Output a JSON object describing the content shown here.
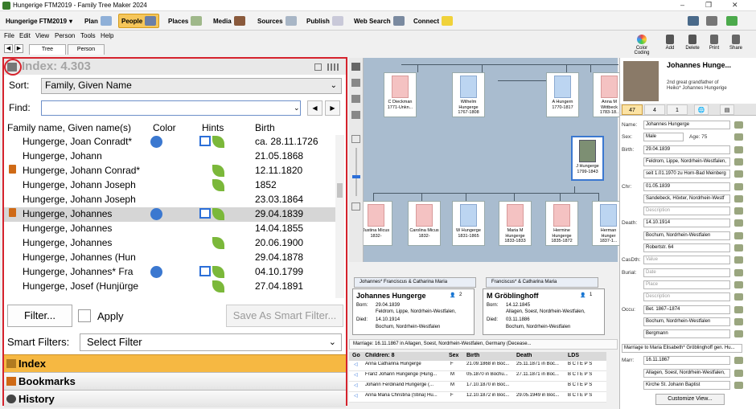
{
  "window": {
    "title": "Hungerige FTM2019 - Family Tree Maker 2024",
    "controls": [
      "–",
      "❐",
      "✕"
    ]
  },
  "toolbar": {
    "tree_name": "Hungerige FTM2019",
    "tabs": [
      {
        "label": "Plan",
        "icon": "plan-icon"
      },
      {
        "label": "People",
        "icon": "people-icon",
        "active": true
      },
      {
        "label": "Places",
        "icon": "map-icon"
      },
      {
        "label": "Media",
        "icon": "media-icon"
      },
      {
        "label": "Sources",
        "icon": "sources-icon"
      },
      {
        "label": "Publish",
        "icon": "publish-icon"
      },
      {
        "label": "Web Search",
        "icon": "web-search-icon"
      },
      {
        "label": "Connect",
        "icon": "connect-icon"
      }
    ]
  },
  "menu": [
    "File",
    "Edit",
    "View",
    "Person",
    "Tools",
    "Help"
  ],
  "subtabs": [
    "Tree",
    "Person"
  ],
  "right_tools": [
    "Color Coding",
    "Add",
    "Delete",
    "Print",
    "Share"
  ],
  "index": {
    "title": "Index: 4.303",
    "sort_label": "Sort:",
    "sort_value": "Family, Given Name",
    "find_label": "Find:",
    "find_value": "",
    "columns": [
      "Family name, Given name(s)",
      "Color",
      "Hints",
      "Birth"
    ],
    "rows": [
      {
        "name": "Hungerge, Joan Conradt*",
        "birth": "ca. 28.11.1726",
        "book": false,
        "dot": true,
        "hint_box": true,
        "leaf": true
      },
      {
        "name": "Hungerge, Johann",
        "birth": "21.05.1868",
        "book": false,
        "dot": false,
        "hint_box": false,
        "leaf": false
      },
      {
        "name": "Hungerge, Johann Conrad*",
        "birth": "12.11.1820",
        "book": true,
        "dot": false,
        "hint_box": false,
        "leaf": true
      },
      {
        "name": "Hungerge, Johann Joseph",
        "birth": "1852",
        "book": false,
        "dot": false,
        "hint_box": false,
        "leaf": true
      },
      {
        "name": "Hungerge, Johann Joseph",
        "birth": "23.03.1864",
        "book": false,
        "dot": false,
        "hint_box": false,
        "leaf": false
      },
      {
        "name": "Hungerge, Johannes",
        "birth": "29.04.1839",
        "book": true,
        "dot": true,
        "hint_box": true,
        "leaf": true,
        "selected": true
      },
      {
        "name": "Hungerge, Johannes",
        "birth": "14.04.1855",
        "book": false,
        "dot": false,
        "hint_box": false,
        "leaf": false
      },
      {
        "name": "Hungerge, Johannes",
        "birth": "20.06.1900",
        "book": false,
        "dot": false,
        "hint_box": false,
        "leaf": true
      },
      {
        "name": "Hungerge, Johannes (Hun",
        "birth": "29.04.1878",
        "book": false,
        "dot": false,
        "hint_box": false,
        "leaf": false
      },
      {
        "name": "Hungerge, Johannes* Fra",
        "birth": "04.10.1799",
        "book": false,
        "dot": true,
        "hint_box": true,
        "leaf": true
      },
      {
        "name": "Hungerge, Josef (Hunjürge",
        "birth": "27.04.1891",
        "book": false,
        "dot": false,
        "hint_box": false,
        "leaf": true
      }
    ],
    "filter_button": "Filter...",
    "apply_label": "Apply",
    "save_smart_filter": "Save As Smart Filter...",
    "smart_filters_label": "Smart Filters:",
    "smart_filters_value": "Select Filter",
    "sections": [
      "Index",
      "Bookmarks",
      "History"
    ]
  },
  "tree": {
    "top_row": [
      {
        "name": "C Dieckman",
        "dates": "1771-Unkn...",
        "sex": "f"
      },
      {
        "name": "Wilhelm Hungerge",
        "dates": "1767-1808",
        "sex": "m"
      },
      {
        "name": "A Hungern",
        "dates": "1770-1817",
        "sex": "m"
      },
      {
        "name": "Anna M Wittbeck",
        "dates": "1783-18..",
        "sex": "f"
      }
    ],
    "focus": {
      "name": "J Hungerge",
      "dates": "1799-1843"
    },
    "bottom_row": [
      {
        "name": "Justina Micus",
        "dates": "1832-",
        "sex": "f"
      },
      {
        "name": "Carolina Micus",
        "dates": "1832-",
        "sex": "f"
      },
      {
        "name": "W Hungerge",
        "dates": "1831-1865",
        "sex": "m"
      },
      {
        "name": "Maria M Hungerge",
        "dates": "1833-1833",
        "sex": "f"
      },
      {
        "name": "Hermine Hungerge",
        "dates": "1835-1872",
        "sex": "f"
      },
      {
        "name": "Herman Hunger",
        "dates": "1837-1...",
        "sex": "m"
      }
    ]
  },
  "family": {
    "parents_left": "Johannes* Franciscus & Catharina Maria",
    "parents_right": "Franciscus* & Catharina Maria",
    "husband": {
      "name": "Johannes Hungerge",
      "born": "29.04.1839",
      "born_place": "Feldrom, Lippe, Nordrhein-Westfalen,",
      "died": "14.10.1914",
      "died_place": "Bochum, Nordrhein-Westfalen",
      "count": "2"
    },
    "wife": {
      "name": "M Gröblinghoff",
      "born": "14.12.1845",
      "born_place": "Allagen, Soest, Nordrhein-Westfalen,",
      "died": "03.11.1886",
      "died_place": "Bochum, Nordrhein-Westfalen",
      "count": "1"
    },
    "born_label": "Born:",
    "died_label": "Died:",
    "marriage": "Marriage:  16.11.1867 in Allagen, Soest, Nordrhein-Westfalen, Germany (Decease...",
    "children_header": [
      "Go",
      "Children: 8",
      "Sex",
      "Birth",
      "Death",
      "LDS"
    ],
    "children": [
      {
        "name": "Anna Catharina Hungerge",
        "sex": "F",
        "birth": "21.09.1868 in Boc...",
        "death": "25.11.1871 in Boc...",
        "lds": "B C I E P S"
      },
      {
        "name": "Franz Johann Hungerige (Hung...",
        "sex": "M",
        "birth": "05.1870 in Bochu...",
        "death": "27.11.1871 in Boc...",
        "lds": "B C I E P S"
      },
      {
        "name": "Johann Ferdinand Hungerge (...",
        "sex": "M",
        "birth": "17.10.1870 in Boc...",
        "death": "",
        "lds": "B C I E P S"
      },
      {
        "name": "Anna Maria Christina (Stina) Hu...",
        "sex": "F",
        "birth": "12.10.1872 in Boc...",
        "death": "29.05.1949 in Boc...",
        "lds": "B C I E P S"
      }
    ]
  },
  "person": {
    "name": "Johannes Hunge...",
    "relationship": "2nd great grandfather of Heiko* Johannes Hungerige",
    "tab_counts": [
      "47",
      "4",
      "1"
    ],
    "fields": [
      {
        "label": "Name:",
        "value": "Johannes Hungerge",
        "ph": false
      },
      {
        "label": "Sex:",
        "value": "Male",
        "ph": false,
        "extra": "Age: 75"
      },
      {
        "label": "Birth:",
        "value": "29.04.1839",
        "ph": false
      },
      {
        "label": "",
        "value": "Feldrom, Lippe, Nordrhein-Westfalen,",
        "ph": false
      },
      {
        "label": "",
        "value": "seit 1.01.1970 zu Horn-Bad Meinberg",
        "ph": false
      },
      {
        "label": "Chr:",
        "value": "01.05.1839",
        "ph": false
      },
      {
        "label": "",
        "value": "Sandebeck, Höxter, Nordrhein-Westf",
        "ph": false
      },
      {
        "label": "",
        "value": "Description",
        "ph": true
      },
      {
        "label": "Death:",
        "value": "14.10.1914",
        "ph": false
      },
      {
        "label": "",
        "value": "Bochum, Nordrhein-Westfalen",
        "ph": false
      },
      {
        "label": "",
        "value": "Robertstr. 64",
        "ph": false
      },
      {
        "label": "CasDth:",
        "value": "Value",
        "ph": true
      },
      {
        "label": "Burial:",
        "value": "Date",
        "ph": true
      },
      {
        "label": "",
        "value": "Place",
        "ph": true
      },
      {
        "label": "",
        "value": "Description",
        "ph": true
      },
      {
        "label": "Occu:",
        "value": "Bet. 1867–1874",
        "ph": false
      },
      {
        "label": "",
        "value": "Bochum, Nordrhein-Westfalen",
        "ph": false
      },
      {
        "label": "",
        "value": "Bergmann",
        "ph": false
      }
    ],
    "marriage_to": "Marriage to Maria Elisabeth* Gröblinghoff gen. Hu...",
    "marr_fields": [
      {
        "label": "Marr:",
        "value": "16.11.1867"
      },
      {
        "label": "",
        "value": "Allagen, Soest, Nordrhein-Westfalen,"
      },
      {
        "label": "",
        "value": "Kirche St. Johann Baptist"
      }
    ],
    "customize": "Customize View..."
  }
}
